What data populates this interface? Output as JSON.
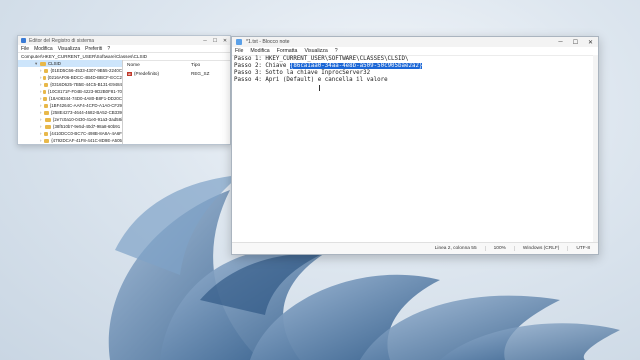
{
  "registry": {
    "title": "Editor del Registro di sistema",
    "menu": [
      "File",
      "Modifica",
      "Visualizza",
      "Preferiti",
      "?"
    ],
    "address": "Computer\\HKEY_CURRENT_USER\\Software\\Classes\\CLSID",
    "tree": [
      {
        "label": "CLSID",
        "selected": true
      },
      {
        "label": "{01ED5C66-4533-4307-9B55-2240C",
        "selected": false
      },
      {
        "label": "{0216AF06-BDCC-4B4D-BBCF-ECC2",
        "selected": false
      },
      {
        "label": "{0316D625-7B5E-44C5-B131-E9484",
        "selected": false
      },
      {
        "label": "{10C8171F-F04B-4223-9D2B0F81-70",
        "selected": false
      },
      {
        "label": "{18A08344-74D0-4A80-B8F1-DD20C",
        "selected": false
      },
      {
        "label": "{1BF4264C-AAF4-4CFD-A1A0-CF29",
        "selected": false
      },
      {
        "label": "{258E4273-4644-4682-BA52-CB339",
        "selected": false
      },
      {
        "label": "{2e7c0a10-0430-41e0-91a3-3ad58i",
        "selected": false
      },
      {
        "label": "{38f510b7-9e5d-40d7-98a8-60b91",
        "selected": false
      },
      {
        "label": "{4410DCC0-BC7C-498B-8A8A-4A6F",
        "selected": false
      },
      {
        "label": "{4792DCAF-41F8-441C-8D9E-A505",
        "selected": false
      }
    ],
    "columns": {
      "name": "Nome",
      "type": "Tipo"
    },
    "values": [
      {
        "name": "(Predefinito)",
        "type": "REG_SZ"
      }
    ]
  },
  "notepad": {
    "title": "*1.txt - Blocco note",
    "menu": [
      "File",
      "Modifica",
      "Formatta",
      "Visualizza",
      "?"
    ],
    "lines": [
      "Passo 1: HKEY_CURRENT_USER\\SOFTWARE\\CLASSES\\CLSID\\",
      "Passo 3: Sotto la chiave InprocServer32",
      "Passo 4: Apri (Default) e cancella il valore"
    ],
    "line2_prefix": "Passo 2: Chiave ",
    "line2_selected": "{86ca1aa0-34aa-4e8b-a509-50c905bae2a2}",
    "status": {
      "position": "Linea 2, colonna 55",
      "zoom": "100%",
      "eol": "Windows (CRLF)",
      "encoding": "UTF-8"
    }
  },
  "colors": {
    "selection": "#1c67d6",
    "wallpaper": "#c9d6e3",
    "bloom": "#3f6b98"
  }
}
